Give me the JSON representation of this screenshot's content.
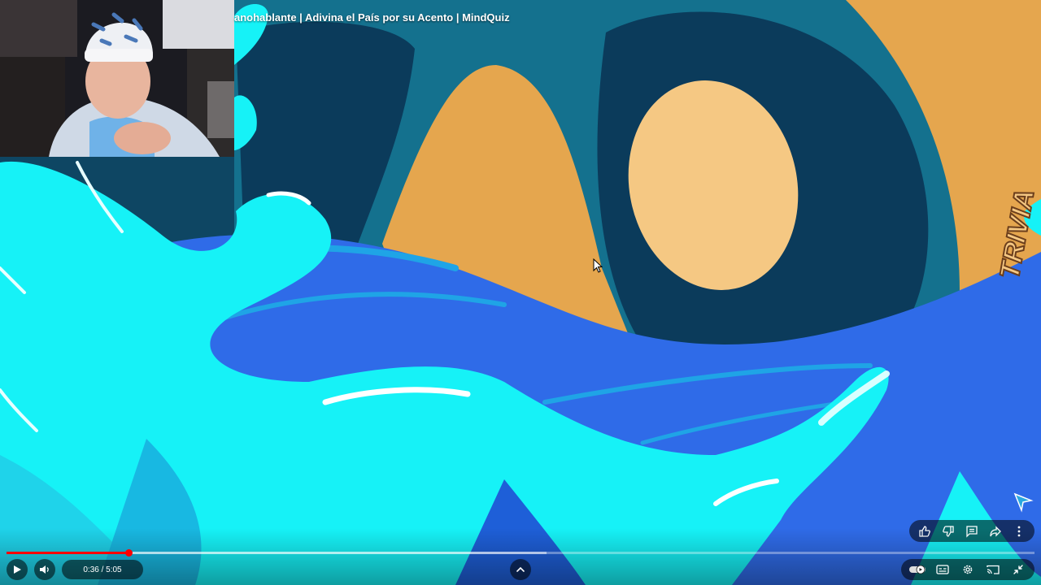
{
  "video": {
    "title": "anohablante | Adivina el País por su Acento | MindQuiz",
    "watermark": "TRIVIA",
    "progress": {
      "played_fraction": 0.1186,
      "buffered_fraction": 0.525
    }
  },
  "controls": {
    "time_display": "0:36 / 5:05"
  },
  "icons": {
    "play": "play-icon",
    "volume": "volume-icon",
    "expand": "chevron-up-icon",
    "like": "thumb-up-icon",
    "dislike": "thumb-down-icon",
    "comments": "comment-icon",
    "share": "share-icon",
    "more": "more-vert-icon",
    "autoplay": "autoplay-toggle-icon",
    "subtitles": "subtitles-icon",
    "settings": "gear-icon",
    "cast": "cast-icon",
    "exit_fullscreen": "exit-fullscreen-icon"
  },
  "colors": {
    "progress_played": "#ff0000",
    "deep_blue": "#2f6be8",
    "cyan": "#16f2f7",
    "orange": "#e5a64e",
    "navy": "#0b3b5b"
  }
}
